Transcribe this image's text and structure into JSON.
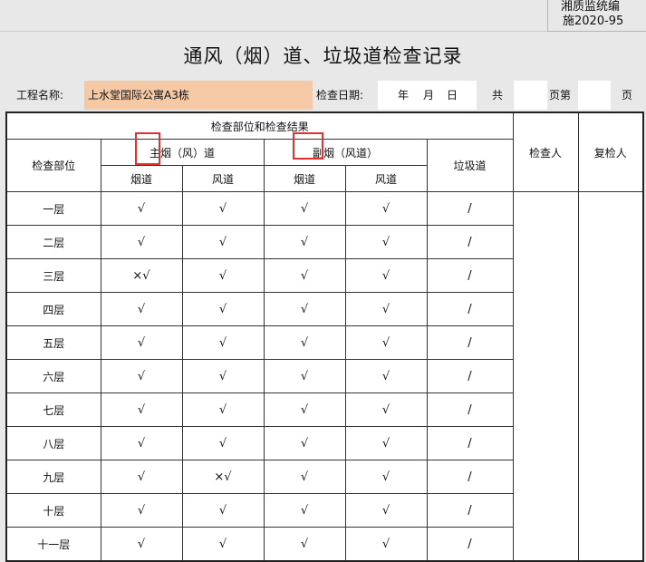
{
  "doc_code": {
    "line1": "湘质监统编",
    "line2": "施2020-95"
  },
  "title": "通风（烟）道、垃圾道检查记录",
  "project": {
    "label": "工程名称:",
    "value": "上水堂国际公寓A3栋"
  },
  "date": {
    "label": "检查日期:",
    "year": "年",
    "month": "月",
    "day": "日"
  },
  "pages": {
    "total_label": "共",
    "page_label": "页第",
    "tail": "页"
  },
  "table": {
    "group_header": "检查部位和检查结果",
    "col_location": "检查部位",
    "main_flue": "主烟（风）道",
    "sub_flue": "副烟（风道）",
    "garbage": "垃圾道",
    "inspector": "检查人",
    "reinspector": "复检人",
    "smoke": "烟道",
    "air": "风道",
    "rows": [
      {
        "floor": "一层",
        "c1": "√",
        "c2": "√",
        "c3": "√",
        "c4": "√",
        "c5": "/"
      },
      {
        "floor": "二层",
        "c1": "√",
        "c2": "√",
        "c3": "√",
        "c4": "√",
        "c5": "/"
      },
      {
        "floor": "三层",
        "c1": "×√",
        "c2": "√",
        "c3": "√",
        "c4": "√",
        "c5": "/"
      },
      {
        "floor": "四层",
        "c1": "√",
        "c2": "√",
        "c3": "√",
        "c4": "√",
        "c5": "/"
      },
      {
        "floor": "五层",
        "c1": "√",
        "c2": "√",
        "c3": "√",
        "c4": "√",
        "c5": "/"
      },
      {
        "floor": "六层",
        "c1": "√",
        "c2": "√",
        "c3": "√",
        "c4": "√",
        "c5": "/"
      },
      {
        "floor": "七层",
        "c1": "√",
        "c2": "√",
        "c3": "√",
        "c4": "√",
        "c5": "/"
      },
      {
        "floor": "八层",
        "c1": "√",
        "c2": "√",
        "c3": "√",
        "c4": "√",
        "c5": "/"
      },
      {
        "floor": "九层",
        "c1": "√",
        "c2": "×√",
        "c3": "√",
        "c4": "√",
        "c5": "/"
      },
      {
        "floor": "十层",
        "c1": "√",
        "c2": "√",
        "c3": "√",
        "c4": "√",
        "c5": "/"
      },
      {
        "floor": "十一层",
        "c1": "√",
        "c2": "√",
        "c3": "√",
        "c4": "√",
        "c5": "/"
      }
    ]
  }
}
